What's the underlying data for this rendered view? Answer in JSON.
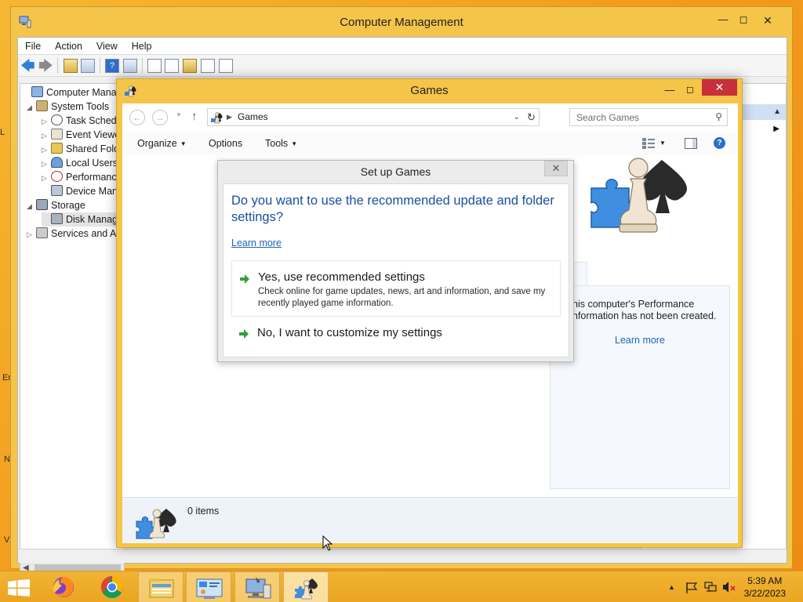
{
  "desktop": {
    "edge_labels": [
      "L",
      "Er",
      "N",
      "V"
    ]
  },
  "computer_management": {
    "title": "Computer Management",
    "menu": [
      "File",
      "Action",
      "View",
      "Help"
    ],
    "tree": [
      {
        "label": "Computer Manage",
        "level": 0,
        "expander": ""
      },
      {
        "label": "System Tools",
        "level": 1,
        "expander": "◢"
      },
      {
        "label": "Task Schedu",
        "level": 2,
        "expander": "▷"
      },
      {
        "label": "Event Viewe",
        "level": 2,
        "expander": "▷"
      },
      {
        "label": "Shared Folde",
        "level": 2,
        "expander": "▷"
      },
      {
        "label": "Local Users",
        "level": 2,
        "expander": "▷"
      },
      {
        "label": "Performanc",
        "level": 2,
        "expander": "▷"
      },
      {
        "label": "Device Man",
        "level": 2,
        "expander": ""
      },
      {
        "label": "Storage",
        "level": 1,
        "expander": "◢"
      },
      {
        "label": "Disk Manag",
        "level": 2,
        "expander": ""
      },
      {
        "label": "Services and Ap",
        "level": 1,
        "expander": "▷"
      }
    ]
  },
  "games": {
    "title": "Games",
    "address": {
      "crumb": "Games"
    },
    "search": {
      "placeholder": "Search Games"
    },
    "commands": {
      "organize": "Organize",
      "options": "Options",
      "tools": "Tools"
    },
    "detail": {
      "text": "his computer's Performance\nnformation has not been created.",
      "learn_more": "Learn more"
    },
    "status": {
      "items": "0 items"
    }
  },
  "setup_dialog": {
    "title": "Set up Games",
    "question": "Do you want to use the recommended update and folder settings?",
    "learn_more": "Learn more",
    "option_yes": {
      "title": "Yes, use recommended settings",
      "description": "Check online for game updates, news, art and information, and save my recently played game information."
    },
    "option_no": {
      "title": "No, I want to customize my settings"
    }
  },
  "taskbar": {
    "time": "5:39 AM",
    "date": "3/22/2023"
  },
  "colors": {
    "accent_blue": "#1a4fa0",
    "link": "#1b64b3",
    "close_red": "#c7303b",
    "window_frame": "#f5c54a"
  }
}
